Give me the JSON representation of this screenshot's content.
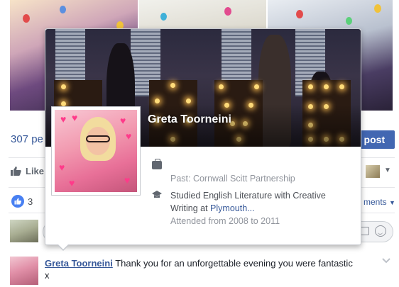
{
  "post": {
    "people_count_text": "307 pe",
    "post_button_label": "t post",
    "like_action_label": "Like",
    "like_count": "3",
    "comments_filter_label": "ments"
  },
  "comment": {
    "author": "Greta Toorneini",
    "text": "Thank you for an unforgettable evening you were fantastic x"
  },
  "hovercard": {
    "name": "Greta Toorneini",
    "cover_sign_letters": [
      "L",
      "O",
      "V",
      "E"
    ],
    "work": {
      "text": "Past: Cornwall Scitt Partnership"
    },
    "education": {
      "prefix": "Studied English Literature with Creative Writing at ",
      "school_link": "Plymouth...",
      "attended": "Attended from 2008 to 2011"
    }
  },
  "icons": {
    "work": "briefcase-icon",
    "education": "graduation-cap-icon",
    "like_action": "thumbs-up-icon",
    "like_badge": "like-reaction-icon",
    "camera": "camera-icon",
    "emoji": "smile-icon",
    "comment_options": "chevron-down-icon"
  },
  "colors": {
    "link": "#365899",
    "primary_button": "#4267b2",
    "like_badge": "#4880f2",
    "muted_text": "#90949c"
  }
}
